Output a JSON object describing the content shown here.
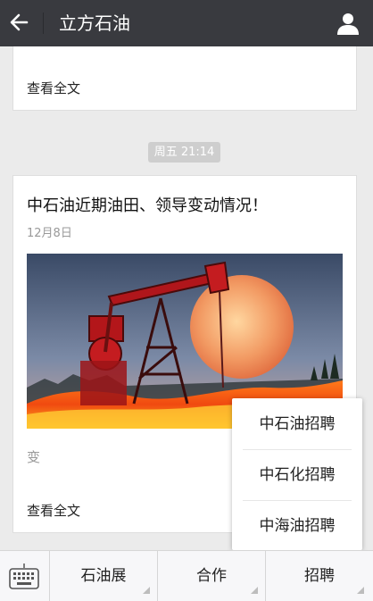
{
  "header": {
    "title": "立方石油",
    "back_icon": "arrow-left-icon",
    "profile_icon": "person-icon"
  },
  "feed": {
    "card1": {
      "read_all": "查看全文"
    },
    "time_badge": "周五 21:14",
    "card2": {
      "headline": "中石油近期油田、领导变动情况！",
      "date": "12月8日",
      "excerpt": "变",
      "read_all": "查看全文"
    }
  },
  "popup_menu": {
    "items": [
      "中石油招聘",
      "中石化招聘",
      "中海油招聘"
    ]
  },
  "bottom_menu": {
    "keyboard_icon": "keyboard-icon",
    "items": [
      "石油展",
      "合作",
      "招聘"
    ]
  },
  "colors": {
    "header_bg": "#393a3f",
    "page_bg": "#ebebeb",
    "badge_bg": "#cecece"
  }
}
